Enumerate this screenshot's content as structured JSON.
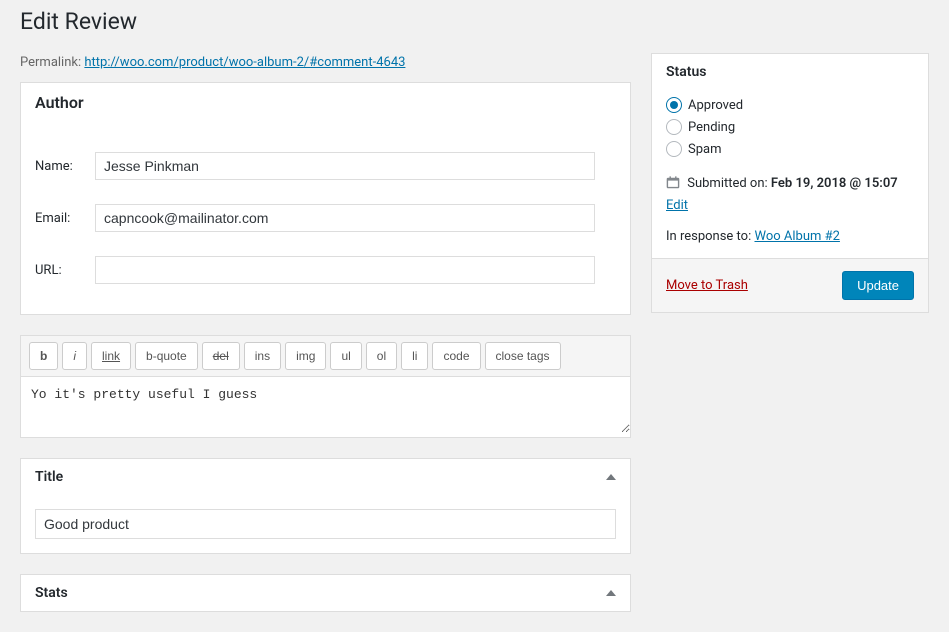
{
  "page": {
    "title": "Edit Review"
  },
  "permalink": {
    "label": "Permalink:",
    "url": "http://woo.com/product/woo-album-2/#comment-4643"
  },
  "author": {
    "heading": "Author",
    "name_label": "Name:",
    "name_value": "Jesse Pinkman",
    "email_label": "Email:",
    "email_value": "capncook@mailinator.com",
    "url_label": "URL:",
    "url_value": ""
  },
  "editor": {
    "buttons": {
      "b": "b",
      "i": "i",
      "link": "link",
      "bquote": "b-quote",
      "del": "del",
      "ins": "ins",
      "img": "img",
      "ul": "ul",
      "ol": "ol",
      "li": "li",
      "code": "code",
      "close": "close tags"
    },
    "content": "Yo it's pretty useful I guess"
  },
  "title_box": {
    "heading": "Title",
    "value": "Good product"
  },
  "stats_box": {
    "heading": "Stats"
  },
  "status": {
    "heading": "Status",
    "options": {
      "approved": "Approved",
      "pending": "Pending",
      "spam": "Spam"
    },
    "submitted_label": "Submitted on:",
    "submitted_value": "Feb 19, 2018 @ 15:07",
    "edit_label": "Edit",
    "response_label": "In response to:",
    "response_target": "Woo Album #2",
    "trash_label": "Move to Trash",
    "update_label": "Update"
  }
}
